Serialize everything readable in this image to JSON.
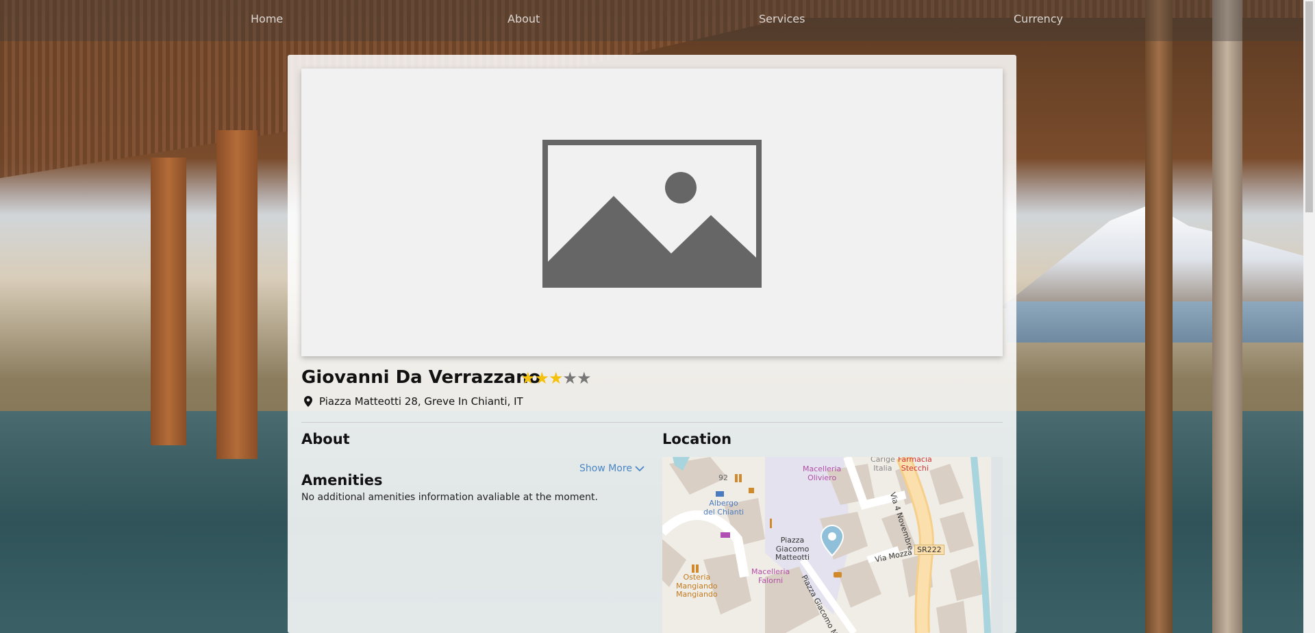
{
  "nav": {
    "items": [
      "Home",
      "About",
      "Services",
      "Currency"
    ]
  },
  "hotel": {
    "name": "Giovanni Da Verrazzano",
    "rating": 3,
    "max_rating": 5,
    "address": "Piazza Matteotti 28, Greve In Chianti, IT"
  },
  "about": {
    "title": "About",
    "show_more": "Show More"
  },
  "amenities": {
    "title": "Amenities",
    "text": "No additional amenities information avaliable at the moment."
  },
  "location": {
    "title": "Location",
    "map": {
      "labels": {
        "oliviero": "Macelleria\nOliviero",
        "italia": "Carige\nItalia",
        "stecchi": "Farmacia\nStecchi",
        "albergo": "Albergo\ndel Chianti",
        "piazza": "Piazza\nGiacomo\nMatteotti",
        "falorni": "Macelleria\nFalorni",
        "osteria": "Osteria\nMangiando\nMangiando",
        "num92": "92"
      },
      "roads": {
        "via4nov": "Via 4 Novembre",
        "viamozza": "Via Mozza",
        "sr222": "SR222",
        "piazzaGM": "Piazza Giacomo Ma"
      }
    }
  },
  "colors": {
    "star_on": "#f4c20d",
    "star_off": "#777777",
    "link": "#4a86c5",
    "map_pin": "#8fbfd9"
  }
}
